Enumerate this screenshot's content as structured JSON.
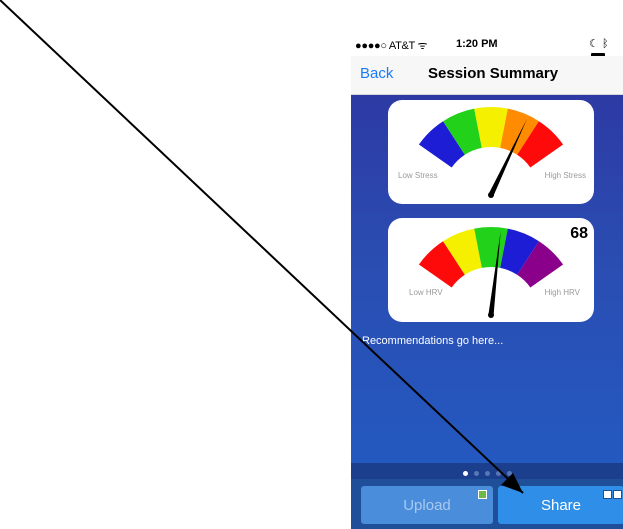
{
  "status_bar": {
    "carrier": "●●●●○ AT&T",
    "wifi_icon": "wifi-icon",
    "time": "1:20 PM",
    "moon_icon": "moon-icon",
    "bluetooth_icon": "bluetooth-icon",
    "battery_icon": "battery-icon"
  },
  "nav": {
    "back_label": "Back",
    "title": "Session Summary"
  },
  "stress_gauge": {
    "low_label": "Low Stress",
    "high_label": "High Stress",
    "segment_colors": [
      "#1d1dd6",
      "#22d11a",
      "#f4f000",
      "#ff8c00",
      "#ff0a0a"
    ],
    "needle_fraction": 0.73
  },
  "hrv_gauge": {
    "low_label": "Low HRV",
    "high_label": "High HRV",
    "value": "68",
    "segment_colors": [
      "#ff0a0a",
      "#f4f000",
      "#22d11a",
      "#1d1dd6",
      "#8a008a"
    ],
    "needle_fraction": 0.56
  },
  "recommendations_text": "Recommendations go here...",
  "pager": {
    "count": 5,
    "active_index": 0
  },
  "actions": {
    "upload_label": "Upload",
    "share_label": "Share"
  },
  "colors": {
    "accent": "#1a7cf5",
    "content_background": "#2a4db2",
    "bottom_bar": "#1f4f98"
  }
}
